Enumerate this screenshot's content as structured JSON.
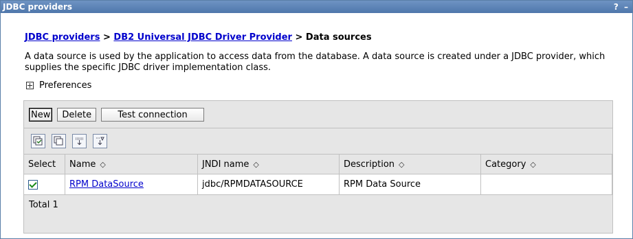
{
  "window": {
    "title": "JDBC providers",
    "help_label": "?",
    "minimize_label": "–"
  },
  "breadcrumb": {
    "link1": "JDBC providers",
    "sep1": " > ",
    "link2": "DB2 Universal JDBC Driver Provider",
    "sep2": " > ",
    "current": "Data sources"
  },
  "description": "A data source is used by the application to access data from the database. A data source is created under a JDBC provider, which supplies the specific JDBC driver implementation class.",
  "preferences": {
    "label": "Preferences"
  },
  "buttons": {
    "new": "New",
    "delete": "Delete",
    "test": "Test connection"
  },
  "toolbar_icons": [
    "select-all-icon",
    "deselect-all-icon",
    "show-filter-icon",
    "clear-filter-icon"
  ],
  "table": {
    "headers": {
      "select": "Select",
      "name": "Name",
      "jndi": "JNDI name",
      "description": "Description",
      "category": "Category"
    },
    "sort_glyph": "◇",
    "rows": [
      {
        "selected": true,
        "name": "RPM DataSource",
        "jndi": "jdbc/RPMDATASOURCE",
        "description": "RPM Data Source",
        "category": ""
      }
    ],
    "total": "Total 1"
  }
}
